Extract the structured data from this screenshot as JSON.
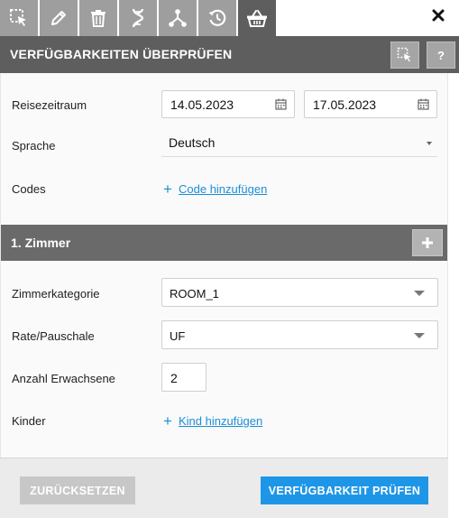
{
  "tabs": [
    {
      "icon": "selection-cursor-icon",
      "active": false
    },
    {
      "icon": "pencil-icon",
      "active": false
    },
    {
      "icon": "trash-icon",
      "active": false
    },
    {
      "icon": "dna-icon",
      "active": false
    },
    {
      "icon": "network-icon",
      "active": false
    },
    {
      "icon": "history-icon",
      "active": false
    },
    {
      "icon": "basket-icon",
      "active": true
    }
  ],
  "close_label": "✖",
  "header": {
    "title": "VERFÜGBARKEITEN ÜBERPRÜFEN",
    "help_label": "?"
  },
  "form": {
    "travel_period_label": "Reisezeitraum",
    "date_from": "14.05.2023",
    "date_to": "17.05.2023",
    "language_label": "Sprache",
    "language_value": "Deutsch",
    "codes_label": "Codes",
    "add_code_link": "Code hinzufügen"
  },
  "room": {
    "title": "1. Zimmer",
    "add_label": "+",
    "category_label": "Zimmerkategorie",
    "category_value": "ROOM_1",
    "rate_label": "Rate/Pauschale",
    "rate_value": "UF",
    "adults_label": "Anzahl Erwachsene",
    "adults_value": "2",
    "children_label": "Kinder",
    "add_child_link": "Kind hinzufügen"
  },
  "footer": {
    "reset_label": "ZURÜCKSETZEN",
    "check_label": "VERFÜGBARKEIT PRÜFEN"
  },
  "colors": {
    "header_bg": "#5e5e5e",
    "tab_bg": "#9e9e9e",
    "accent_blue": "#1e96e8",
    "link_blue": "#1a8fd8"
  }
}
